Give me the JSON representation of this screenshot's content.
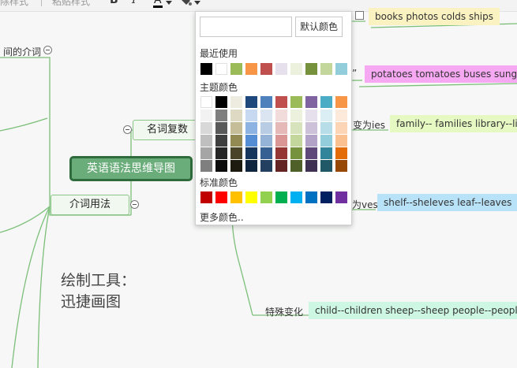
{
  "toolbar": {
    "left_text": "除样式",
    "right_text": "粘贴样式",
    "bold": "B",
    "italic": "I",
    "font_color_glyph": "A",
    "font_color": "#000000"
  },
  "mindmap": {
    "root": "英语语法思维导图",
    "node_plural": "名词复数",
    "node_preposition": "介词用法",
    "left_branch_label": "间的介词",
    "rule_ies": "变为ies",
    "rule_ves": "为ves",
    "rule_special": "特殊变化",
    "ex_books": "books photos colds ships",
    "ex_potatoes": "potatoes tomatoes buses sungla",
    "ex_quote": "”",
    "ex_family": "family-- families library--lib",
    "ex_shelf": "shelf--sheleves leaf--leaves",
    "ex_child": "child--children sheep--sheep people--people",
    "watermark_line1": "绘制工具：",
    "watermark_line2": "迅捷画图"
  },
  "color_panel": {
    "hex_value": "",
    "default_button": "默认颜色",
    "recent_title": "最近使用",
    "theme_title": "主题颜色",
    "standard_title": "标准颜色",
    "more_colors": "更多颜色..",
    "recent_colors": [
      "#000000",
      "#ffffff",
      "#9bbb59",
      "#f79646",
      "#c0504d",
      "#e5e0ec",
      "#ebf1dd",
      "#76923c",
      "#c3d69b",
      "#92cddc"
    ],
    "theme_columns": [
      [
        "#ffffff",
        "#f2f2f2",
        "#d8d8d8",
        "#bfbfbf",
        "#a5a5a5",
        "#7f7f7f"
      ],
      [
        "#000000",
        "#7f7f7f",
        "#595959",
        "#3f3f3f",
        "#262626",
        "#0c0c0c"
      ],
      [
        "#eeece1",
        "#ddd9c3",
        "#c4bd97",
        "#938953",
        "#494429",
        "#1d1b10"
      ],
      [
        "#1f497d",
        "#c6d9f0",
        "#8db3e2",
        "#548dd4",
        "#17365d",
        "#0f243e"
      ],
      [
        "#4f81bd",
        "#dbe5f1",
        "#b8cce4",
        "#95b3d7",
        "#366092",
        "#244061"
      ],
      [
        "#c0504d",
        "#f2dcdb",
        "#e5b9b7",
        "#d99694",
        "#953734",
        "#632423"
      ],
      [
        "#9bbb59",
        "#ebf1dd",
        "#d7e3bc",
        "#c3d69b",
        "#76923c",
        "#4f6128"
      ],
      [
        "#8064a2",
        "#e5e0ec",
        "#ccc1d9",
        "#b2a2c7",
        "#5f497a",
        "#3f3151"
      ],
      [
        "#4bacc6",
        "#dbeef3",
        "#b7dde8",
        "#92cddc",
        "#31859b",
        "#205867"
      ],
      [
        "#f79646",
        "#fdeada",
        "#fbd5b5",
        "#fac08f",
        "#e36c09",
        "#974806"
      ]
    ],
    "standard_colors": [
      "#c00000",
      "#ff0000",
      "#ffc000",
      "#ffff00",
      "#92d050",
      "#00b050",
      "#00b0f0",
      "#0070c0",
      "#002060",
      "#7030a0"
    ]
  },
  "colors": {
    "tag_yellow": "#fbf2c2",
    "tag_pink": "#f7a8f2",
    "tag_lightgreen": "#e7f9c3",
    "tag_lightblue": "#b8e2f8",
    "tag_mint": "#cdf7e3",
    "branch_line": "#7cbf79",
    "root_fill": "#6aad7a",
    "root_border": "#2f6b3c"
  }
}
